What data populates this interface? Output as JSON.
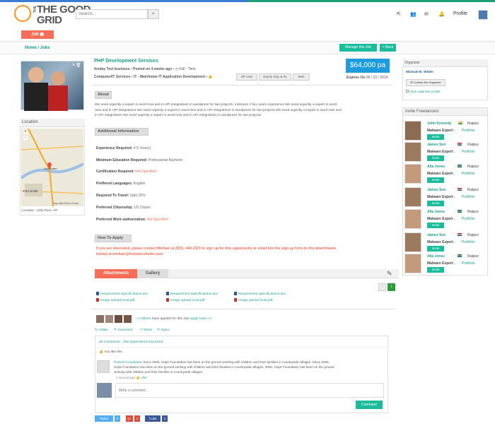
{
  "header": {
    "logo_line1": "THE GOOD",
    "logo_line2": "GRID",
    "logo_the": "THE",
    "search_placeholder": "Search...",
    "profile": "Profile"
  },
  "job_tab": "Job",
  "breadcrumb": "Home / Jobs",
  "buttons": {
    "manage": "Manage this Job",
    "back": "< Back"
  },
  "job": {
    "title": "PHP Development Services",
    "company": "foxday Test business",
    "posted": "Posted on 4 weeks ago",
    "type": "Full - Time",
    "category": "Computer/IT Services",
    "subcategory": "IT - Mainframe  IT Application Development",
    "tags": [
      "HP Unix",
      "Oracle SQL & PL",
      "Web"
    ],
    "price": "$64,000 pa",
    "expires": "Expires On",
    "expires_date": "06 / 23 / 2014"
  },
  "about": {
    "heading": "About",
    "text": "We need urgently a expert in word ress and in API integrations in wordpress for two projects, minimum 4 five years experience We need urgently a expert in word ress and in API integrations We need urgently a expert in word ress and in API integrations in wordpress for two projects We need urgently a expert in word ress and in API integrations We need urgently a expert in word ress and in API integrations in wordpress for two projects"
  },
  "additional": {
    "heading": "Additional Information",
    "rows": [
      {
        "label": "Experience Required:",
        "value": "4-5 Year(s)"
      },
      {
        "label": "Minimum  Education Required:",
        "value": "Professional Bachelor"
      },
      {
        "label": "Certification Required:",
        "value": "Not Specified"
      },
      {
        "label": "Preffered Languages:",
        "value": "English"
      },
      {
        "label": "Required To Travel:",
        "value": "Upto 25%"
      },
      {
        "label": "Preferred Citizenship:",
        "value": "US Citizen"
      },
      {
        "label": "Preferred Work authorization:",
        "value": "Not Specified"
      }
    ]
  },
  "howto": {
    "heading": "How To Apply",
    "text": "If you are interested, please contact Michael at (501) -444-2323 to sign up for this opportunity or email him the sign up form (in the attachments below) at michael@homelesshelter.com"
  },
  "tabs": {
    "attachments": "Attachments",
    "gallery": "Gallery"
  },
  "files": [
    [
      "Requirement Specifications.doc",
      "Image upload Guid.pdf"
    ],
    [
      "Requirement Specifications.doc",
      "Image upload Guid.pdf"
    ],
    [
      "Requirement Specifications.doc",
      "Image upload Guid.pdf"
    ]
  ],
  "applied": {
    "others": "+ 3 Others",
    "text": "have applied for this  Job",
    "apply_now": "Apply Now! >>"
  },
  "actions": {
    "unlike": "Unlike",
    "comment": "Comment",
    "share": "Share",
    "open": "Open"
  },
  "comments": {
    "count": "28 Comments",
    "apps": "256 Applications Received",
    "you_like": "You like this",
    "author": "Protech Foundation",
    "text": "Since 2005, Hope Foundation has been on the ground working with children and their families in countryside villages. Since 2005, Hope Foundation has been on the ground working with children and their families in countryside villages. 2005, Hope Foundation has been on the ground working with children and their families in countryside villages.",
    "time": "1 second ago",
    "like": "Like",
    "placeholder": "Write a comment...",
    "button": "Comment"
  },
  "social": {
    "tweet": "Tweet",
    "tweet_count": "2",
    "gplus": "g+",
    "gplus_count": "1",
    "like": "Like",
    "like_count": "2"
  },
  "location": {
    "heading": "Location",
    "caption": "Location : Little Rock, AR.",
    "map_city1": "Van Buren",
    "map_city2": "Fort Smith",
    "map_data": "Map data  Terms of Use"
  },
  "organizer": {
    "heading": "Organizer",
    "name": "Michael B. White",
    "contact": "Contact the Organizer",
    "view": "View organizer profile"
  },
  "invite": {
    "heading": "Invite Freelancers",
    "items": [
      {
        "name": "John Kennedy",
        "city": "Raipur",
        "skill": "Malware Expert .",
        "portfolio": "Portfolio",
        "invite": "Invite"
      },
      {
        "name": "James Son",
        "city": "Raipur",
        "skill": "Malware Expert .",
        "portfolio": "Portfolio",
        "invite": "Invite"
      },
      {
        "name": "Alia Jones",
        "city": "Raipur",
        "skill": "Malware Expert .",
        "portfolio": "Portfolio",
        "invite": "Invite"
      },
      {
        "name": "James Son",
        "city": "Raipur",
        "skill": "Malware Expert .",
        "portfolio": "Portfolio",
        "invite": "Invite"
      },
      {
        "name": "Alia Jones",
        "city": "Raipur",
        "skill": "Malware Expert .",
        "portfolio": "Portfolio",
        "invite": "Invite"
      },
      {
        "name": "James Son",
        "city": "Raipur",
        "skill": "Malware Expert .",
        "portfolio": "Portfolio",
        "invite": "Invite"
      },
      {
        "name": "Alia Jones",
        "city": "Raipur",
        "skill": "Malware Expert .",
        "portfolio": "Portfolio",
        "invite": "Invite"
      }
    ]
  },
  "colors": {
    "accent": "#1abc9c",
    "brand_orange": "#f76d57",
    "price_blue": "#1e9bdc",
    "logo_orange": "#f7931e"
  },
  "icons": [
    "search-icon",
    "external-link-icon",
    "users-icon",
    "envelope-icon",
    "bell-icon",
    "edit-icon",
    "trash-icon",
    "clock-icon",
    "thumbs-up-icon",
    "share-icon",
    "comment-icon",
    "paperclip-icon"
  ]
}
